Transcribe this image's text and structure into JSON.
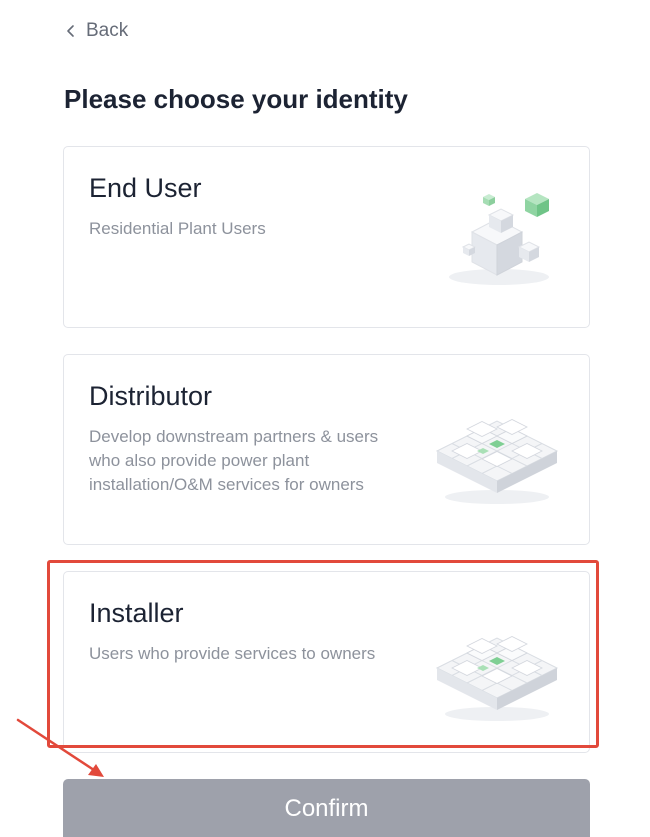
{
  "header": {
    "back_label": "Back",
    "back_icon": "chevron-left-icon"
  },
  "page": {
    "title": "Please choose your identity"
  },
  "cards": [
    {
      "title": "End User",
      "description": "Residential Plant Users",
      "icon": "isometric-cubes-illustration"
    },
    {
      "title": "Distributor",
      "description": "Develop downstream partners & users who also provide power plant installation/O&M services for owners",
      "icon": "isometric-grid-building-illustration"
    },
    {
      "title": "Installer",
      "description": "Users who provide services to owners",
      "icon": "isometric-grid-building-illustration",
      "highlighted": true
    }
  ],
  "footer": {
    "confirm_label": "Confirm"
  },
  "colors": {
    "title_text": "#1c2333",
    "muted_text": "#8d929c",
    "card_border": "#e3e5ea",
    "confirm_button_bg": "#9ea1ab",
    "annotation_red": "#e2493b",
    "accent_green": "#7fcf94"
  }
}
